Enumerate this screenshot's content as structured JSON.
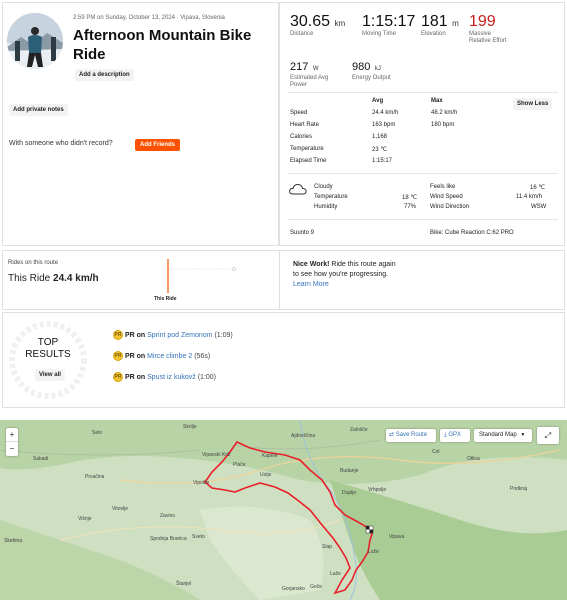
{
  "header": {
    "meta": "2:59 PM on Sunday, October 13, 2024 · Vipava, Slovenia",
    "title": "Afternoon Mountain Bike Ride",
    "add_description": "Add a description",
    "add_private_notes": "Add private notes",
    "with_someone": "With someone who didn't record?",
    "add_friends": "Add Friends"
  },
  "stats": {
    "distance": {
      "value": "30.65",
      "unit": "km",
      "label": "Distance"
    },
    "moving_time": {
      "value": "1:15:17",
      "label": "Moving Time"
    },
    "elevation": {
      "value": "181",
      "unit": "m",
      "label": "Elevation"
    },
    "relative_effort": {
      "value": "199",
      "label1": "Massive",
      "label2": "Relative Effort"
    },
    "power": {
      "value": "217",
      "unit": "W",
      "label1": "Estimated Avg",
      "label2": "Power"
    },
    "energy": {
      "value": "980",
      "unit": "kJ",
      "label": "Energy Output"
    }
  },
  "details": {
    "col_avg": "Avg",
    "col_max": "Max",
    "show_less": "Show Less",
    "rows": [
      {
        "label": "Speed",
        "avg": "24.4 km/h",
        "max": "48.2 km/h"
      },
      {
        "label": "Heart Rate",
        "avg": "163 bpm",
        "max": "180 bpm"
      },
      {
        "label": "Calories",
        "avg": "1,168",
        "max": ""
      },
      {
        "label": "Temperature",
        "avg": "23 ℃",
        "max": ""
      },
      {
        "label": "Elapsed Time",
        "avg": "1:15:17",
        "max": ""
      }
    ]
  },
  "weather": {
    "condition": "Cloudy",
    "temperature_label": "Temperature",
    "temperature": "18 ℃",
    "humidity_label": "Humidity",
    "humidity": "77%",
    "feels_like_label": "Feels like",
    "feels_like": "16 ℃",
    "wind_speed_label": "Wind Speed",
    "wind_speed": "11.4 km/h",
    "wind_direction_label": "Wind Direction",
    "wind_direction": "WSW",
    "icon": "cloud-icon"
  },
  "gear": {
    "device": "Suunto 9",
    "bike": "Bike: Cube Reaction C:62 PRO"
  },
  "route": {
    "heading": "Rides on this route",
    "this_ride_label": "This Ride",
    "this_ride_speed": "24.4 km/h",
    "bar_caption": "This Ride",
    "nice_work_bold": "Nice Work!",
    "nice_work_text1": " Ride this route again",
    "nice_work_text2": "to see how you're progressing.",
    "learn_more": "Learn More"
  },
  "top_results": {
    "line1": "TOP",
    "line2": "RESULTS",
    "view_all": "View all",
    "items": [
      {
        "prefix": "PR on ",
        "segment": "Sprint pod Zemonom",
        "time": "(1:09)"
      },
      {
        "prefix": "PR on ",
        "segment": "Mirce climbe 2",
        "time": "(56s)"
      },
      {
        "prefix": "PR on ",
        "segment": "Spust iz kukovž",
        "time": "(1:00)"
      }
    ]
  },
  "map": {
    "zoom_in": "+",
    "zoom_out": "−",
    "save_route": "Save Route",
    "gpx": "GPX",
    "map_style": "Standard Map",
    "route_color": "#e8202a",
    "towns": [
      "Selo",
      "Skrilje",
      "Ajdovščina",
      "Zalošče",
      "Col",
      "Kapele",
      "Vipavski Križ",
      "Plače",
      "Budanje",
      "Sakadi",
      "Vrhpolje",
      "Podkraj",
      "Prvačina",
      "Vipolže",
      "Ustje",
      "Duplje",
      "Otlica",
      "Zavino",
      "Višnje",
      "Vitovlje",
      "Sveto",
      "Skebina",
      "Spodnja Branica",
      "Slap",
      "Lože",
      "Laže",
      "Štanjel",
      "Gorjansko",
      "Goče",
      "Vipava"
    ]
  },
  "colors": {
    "accent": "#fc5200",
    "link": "#3573b8",
    "effort": "#c81f1f"
  }
}
